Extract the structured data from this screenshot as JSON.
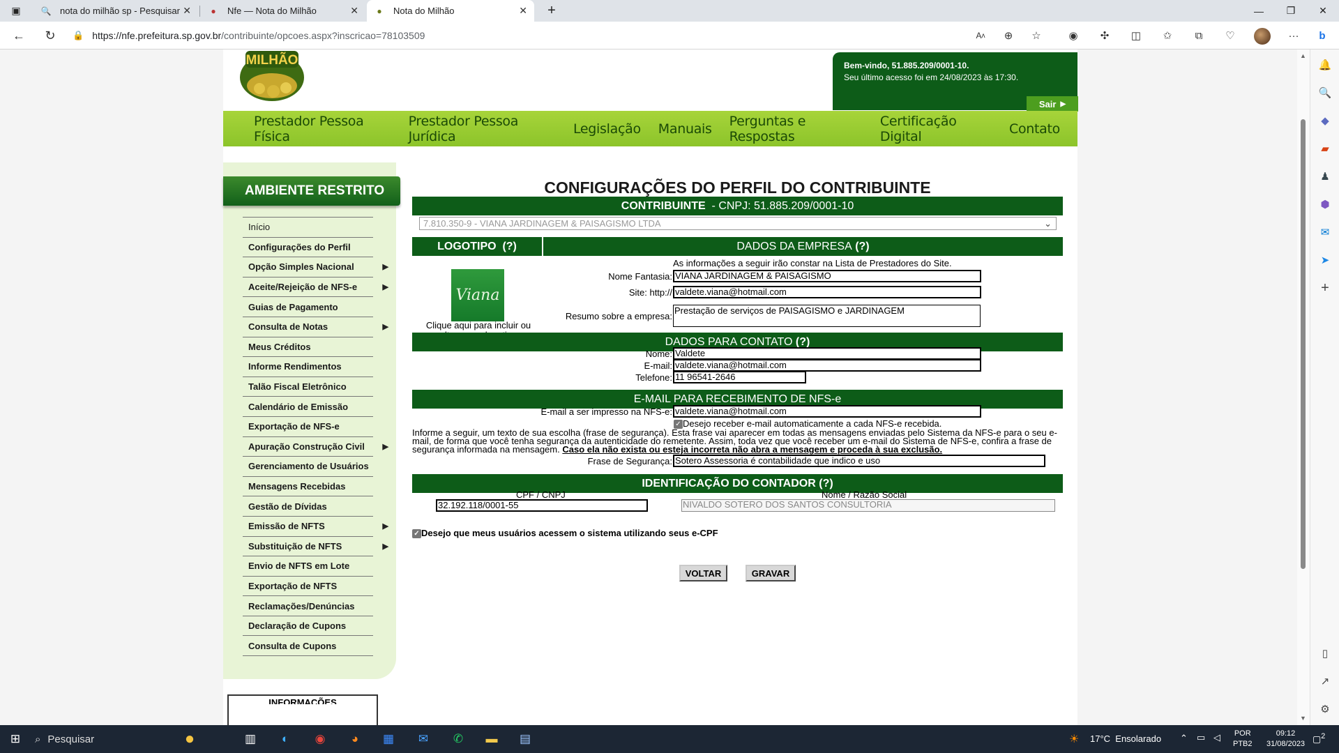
{
  "browser": {
    "tabs": [
      {
        "title": "nota do milhão sp - Pesquisar"
      },
      {
        "title": "Nfe — Nota do Milhão"
      },
      {
        "title": "Nota do Milhão"
      }
    ],
    "url_host": "https://nfe.prefeitura.sp.gov.br",
    "url_path": "/contribuinte/opcoes.aspx?inscricao=78103509"
  },
  "header": {
    "logo_text": "MILHÃO",
    "welcome_line1": "Bem-vindo, 51.885.209/0001-10.",
    "welcome_line2": "Seu último acesso foi em 24/08/2023 às 17:30.",
    "logout": "Sair"
  },
  "menu": [
    "Prestador Pessoa Física",
    "Prestador Pessoa Jurídica",
    "Legislação",
    "Manuais",
    "Perguntas e Respostas",
    "Certificação Digital",
    "Contato"
  ],
  "sidebar": {
    "title": "AMBIENTE RESTRITO",
    "items": [
      "Início",
      "Configurações do Perfil",
      "Opção Simples Nacional",
      "Aceite/Rejeição de NFS-e",
      "Guias de Pagamento",
      "Consulta de Notas",
      "Meus Créditos",
      "Informe Rendimentos",
      "Talão Fiscal Eletrônico",
      "Calendário de Emissão",
      "Exportação de NFS-e",
      "Apuração Construção Civil",
      "Gerenciamento de Usuários",
      "Mensagens Recebidas",
      "Gestão de Dívidas",
      "Emissão de NFTS",
      "Substituição de NFTS",
      "Envio de NFTS em Lote",
      "Exportação de NFTS",
      "Reclamações/Denúncias",
      "Declaração de Cupons",
      "Consulta de Cupons"
    ],
    "info_label": "INFORMAÇÕES"
  },
  "main": {
    "title": "CONFIGURAÇÕES DO PERFIL DO CONTRIBUINTE",
    "contrib_label": "CONTRIBUINTE",
    "contrib_cnpj": "- CNPJ: 51.885.209/0001-10",
    "contrib_select": "7.810.350-9 - VIANA JARDINAGEM & PAISAGISMO LTDA",
    "logo_header": "LOGOTIPO",
    "help": "(?)",
    "logo_caption": "Clique aqui para incluir ou alterar seu logotipo",
    "logo_brand": "Viana",
    "empresa_header": "DADOS DA EMPRESA",
    "empresa_note": "As informações a seguir irão constar na Lista de Prestadores do Site.",
    "nome_fantasia_label": "Nome Fantasia:",
    "nome_fantasia": "VIANA JARDINAGEM & PAISAGISMO",
    "site_label": "Site: http://",
    "site": "valdete.viana@hotmail.com",
    "resumo_label": "Resumo sobre a empresa:",
    "resumo": "Prestação de serviços de PAISAGISMO e JARDINAGEM",
    "contato_header": "DADOS PARA CONTATO",
    "nome_label": "Nome:",
    "nome": "Valdete",
    "email_label": "E-mail:",
    "email": "valdete.viana@hotmail.com",
    "telefone_label": "Telefone:",
    "telefone": "11 96541-2646",
    "nfse_header": "E-MAIL PARA RECEBIMENTO DE NFS-e",
    "nfse_email_label": "E-mail a ser impresso na NFS-e:",
    "nfse_email": "valdete.viana@hotmail.com",
    "auto_email_label": "Desejo receber e-mail automaticamente a cada NFS-e recebida.",
    "info_text": "Informe a seguir, um texto de sua escolha (frase de segurança). Esta frase vai aparecer em todas as mensagens enviadas pelo Sistema da NFS-e para o seu e-mail, de forma que você tenha segurança da autenticidade do remetente. Assim, toda vez que você receber um e-mail do Sistema de NFS-e, confira a frase de segurança informada na mensagem.",
    "info_warning": "Caso ela não exista ou esteja incorreta não abra a mensagem e proceda à sua exclusão.",
    "frase_label": "Frase de Segurança:",
    "frase": "Sotero Assessoria é contabilidade que indico e uso",
    "contador_header": "IDENTIFICAÇÃO DO CONTADOR",
    "cpf_label": "CPF / CNPJ",
    "cpf": "32.192.118/0001-55",
    "razao_label": "Nome / Razão Social",
    "razao": "NIVALDO SOTERO DOS SANTOS CONSULTORIA",
    "ecpf_label": "Desejo que meus usuários acessem o sistema utilizando seus e-CPF",
    "btn_voltar": "VOLTAR",
    "btn_gravar": "GRAVAR"
  },
  "taskbar": {
    "search": "Pesquisar",
    "weather": "17°C",
    "weather_desc": "Ensolarado",
    "lang1": "POR",
    "lang2": "PTB2",
    "time": "09:12",
    "date": "31/08/2023",
    "notif": "2"
  }
}
